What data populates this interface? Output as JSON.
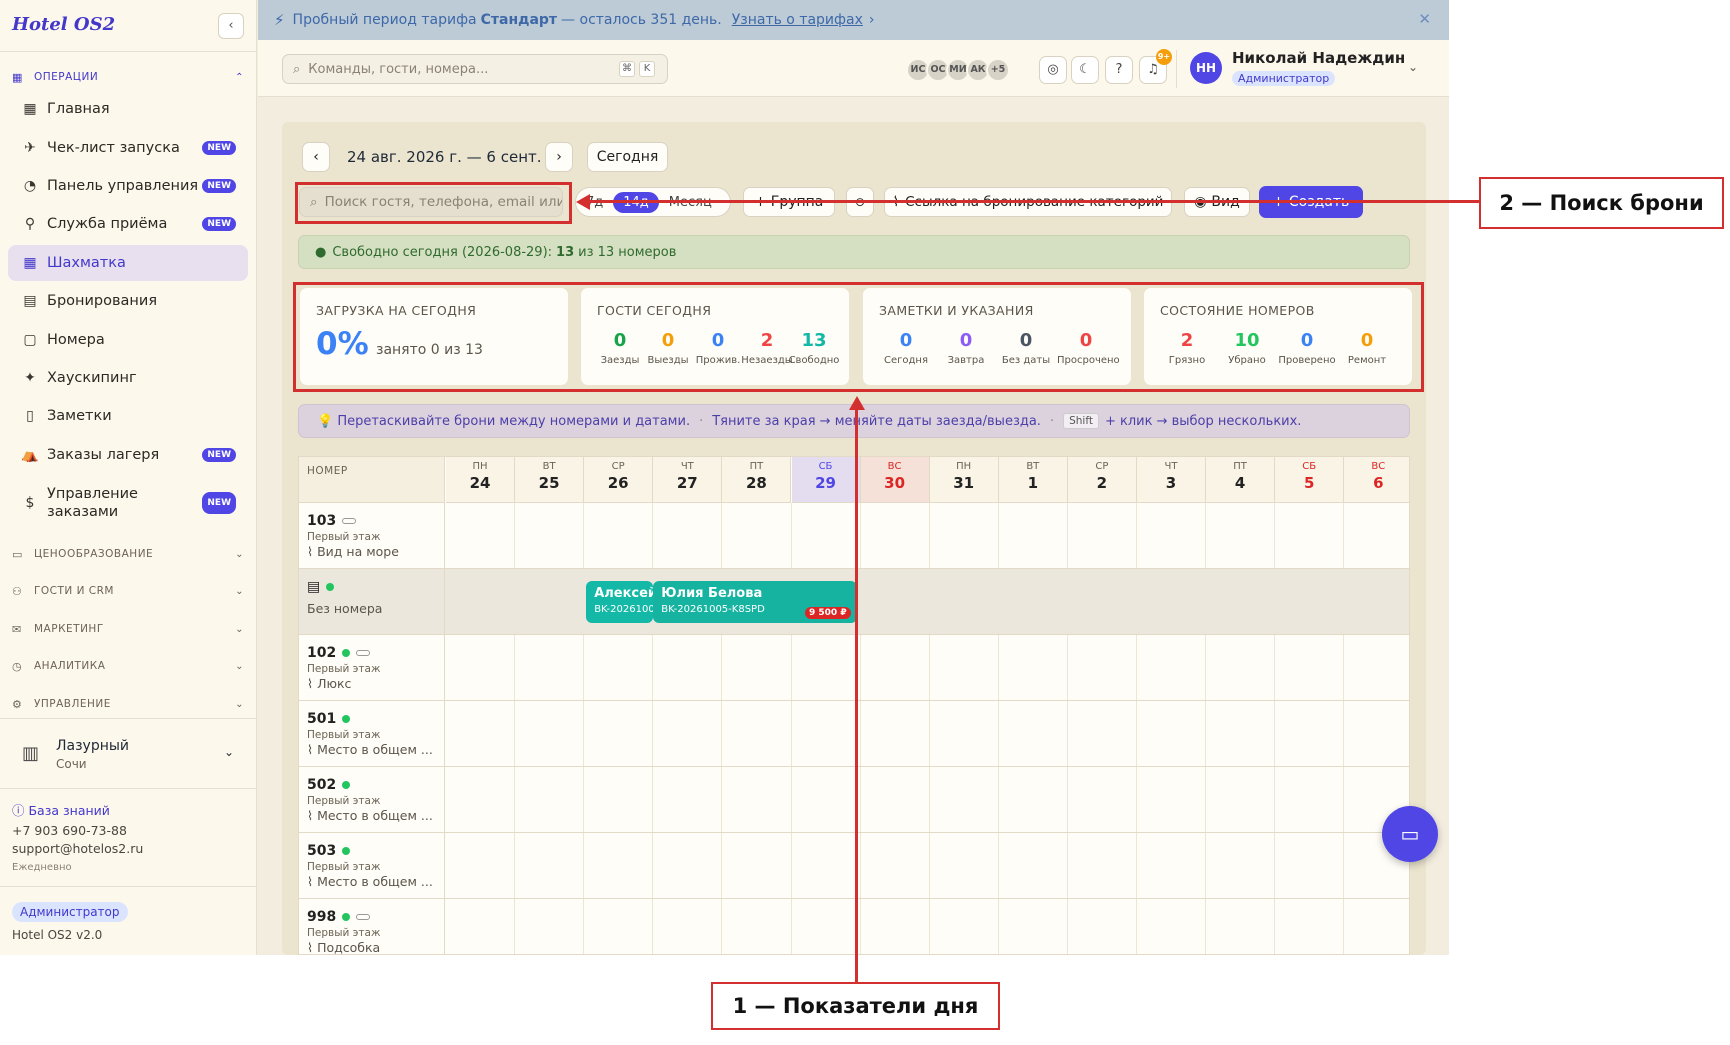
{
  "sidebar": {
    "logo": "Hotel OS2",
    "collapse_icon": "‹",
    "ops_section": "ОПЕРАЦИИ",
    "nav": [
      {
        "label": "Главная",
        "icon": "▦",
        "new": false
      },
      {
        "label": "Чек-лист запуска",
        "icon": "✈",
        "new": true
      },
      {
        "label": "Панель управления",
        "icon": "◔",
        "new": true
      },
      {
        "label": "Служба приёма",
        "icon": "⚲",
        "new": true
      },
      {
        "label": "Шахматка",
        "icon": "▦",
        "new": false,
        "active": true
      },
      {
        "label": "Бронирования",
        "icon": "▤",
        "new": false
      },
      {
        "label": "Номера",
        "icon": "▢",
        "new": false
      },
      {
        "label": "Хаускипинг",
        "icon": "✦",
        "new": false
      },
      {
        "label": "Заметки",
        "icon": "▯",
        "new": false
      },
      {
        "label": "Заказы лагеря",
        "icon": "⛺",
        "new": true
      }
    ],
    "nav_orders": {
      "label_line1": "Управление",
      "label_line2": "заказами",
      "icon": "$",
      "new": true
    },
    "new_badge": "NEW",
    "sections": [
      "ЦЕНООБРАЗОВАНИЕ",
      "ГОСТИ И CRM",
      "МАРКЕТИНГ",
      "АНАЛИТИКА",
      "УПРАВЛЕНИЕ"
    ],
    "property": {
      "name": "Лазурный",
      "city": "Сочи"
    },
    "knowledge_base": "База знаний",
    "phone": "+7 903 690-73-88",
    "email": "support@hotelos2.ru",
    "schedule": "Ежедневно",
    "role": "Администратор",
    "version": "Hotel OS2 v2.0"
  },
  "banner": {
    "text_before": "Пробный период тарифа",
    "plan": "Стандарт",
    "text_after": "— осталось 351 день.",
    "link": "Узнать о тарифах",
    "link_arrow": "›",
    "close": "✕"
  },
  "header": {
    "search_placeholder": "Команды, гости, номера...",
    "kbd1": "⌘",
    "kbd2": "K",
    "avatars": [
      "ИС",
      "ОС",
      "МИ",
      "АК",
      "+5"
    ],
    "notif_badge": "9+",
    "user_initials": "НН",
    "user_name": "Николай Надеждин",
    "user_role": "Администратор"
  },
  "toolbar": {
    "prev": "‹",
    "date_range": "24 авг. 2026 г. — 6 сент.",
    "next": "›",
    "today": "Сегодня",
    "search_placeholder": "Поиск гостя, телефона, email или",
    "seg_7d": "7д",
    "seg_14d": "14д",
    "seg_month": "Месяц",
    "group": "+ Группа",
    "link": "Ссылка на бронирование категорий",
    "view": "Вид",
    "create": "+ Создать"
  },
  "free_today": {
    "prefix": "Свободно сегодня (2026-08-29):",
    "free": "13",
    "suffix": "из 13 номеров"
  },
  "cards": {
    "load": {
      "title": "ЗАГРУЗКА НА СЕГОДНЯ",
      "percent": "0%",
      "sub": "занято 0 из 13"
    },
    "guests": {
      "title": "ГОСТИ СЕГОДНЯ",
      "stats": [
        {
          "value": "0",
          "label": "Заезды",
          "color": "#16a34a"
        },
        {
          "value": "0",
          "label": "Выезды",
          "color": "#f59e0b"
        },
        {
          "value": "0",
          "label": "Прожив.",
          "color": "#3b82f6"
        },
        {
          "value": "2",
          "label": "Незаезды",
          "color": "#ef4444"
        },
        {
          "value": "13",
          "label": "Свободно",
          "color": "#14b8a6"
        }
      ]
    },
    "notes": {
      "title": "ЗАМЕТКИ И УКАЗАНИЯ",
      "stats": [
        {
          "value": "0",
          "label": "Сегодня",
          "color": "#3b82f6"
        },
        {
          "value": "0",
          "label": "Завтра",
          "color": "#8b5cf6"
        },
        {
          "value": "0",
          "label": "Без даты",
          "color": "#4b5563"
        },
        {
          "value": "0",
          "label": "Просрочено",
          "color": "#ef4444"
        }
      ]
    },
    "rooms": {
      "title": "СОСТОЯНИЕ НОМЕРОВ",
      "stats": [
        {
          "value": "2",
          "label": "Грязно",
          "color": "#ef4444"
        },
        {
          "value": "10",
          "label": "Убрано",
          "color": "#22c55e"
        },
        {
          "value": "0",
          "label": "Проверено",
          "color": "#3b82f6"
        },
        {
          "value": "0",
          "label": "Ремонт",
          "color": "#f59e0b"
        }
      ]
    }
  },
  "hint": {
    "part1": "💡 Перетаскивайте брони между номерами и датами.",
    "sep": "·",
    "part2": "Тяните за края → меняйте даты заезда/выезда.",
    "kbd": "Shift",
    "part3": "+ клик → выбор нескольких."
  },
  "grid": {
    "room_header": "НОМЕР",
    "days": [
      {
        "dow": "ПН",
        "num": "24"
      },
      {
        "dow": "ВТ",
        "num": "25"
      },
      {
        "dow": "СР",
        "num": "26"
      },
      {
        "dow": "ЧТ",
        "num": "27"
      },
      {
        "dow": "ПТ",
        "num": "28"
      },
      {
        "dow": "СБ",
        "num": "29",
        "today": true
      },
      {
        "dow": "ВС",
        "num": "30",
        "weekend": true
      },
      {
        "dow": "ПН",
        "num": "31"
      },
      {
        "dow": "ВТ",
        "num": "1"
      },
      {
        "dow": "СР",
        "num": "2"
      },
      {
        "dow": "ЧТ",
        "num": "3"
      },
      {
        "dow": "ПТ",
        "num": "4"
      },
      {
        "dow": "СБ",
        "num": "5",
        "weekend": true
      },
      {
        "dow": "ВС",
        "num": "6",
        "weekend": true
      }
    ],
    "rows": [
      {
        "num": "103",
        "dot": false,
        "pill": true,
        "floor": "Первый этаж",
        "type": "Вид на море"
      },
      {
        "num": "",
        "unassigned": true,
        "label": "Без номера"
      },
      {
        "num": "102",
        "dot": true,
        "pill": true,
        "floor": "Первый этаж",
        "type": "Люкс"
      },
      {
        "num": "501",
        "dot": true,
        "pill": false,
        "floor": "Первый этаж",
        "type": "Место в общем ..."
      },
      {
        "num": "502",
        "dot": true,
        "pill": false,
        "floor": "Первый этаж",
        "type": "Место в общем ..."
      },
      {
        "num": "503",
        "dot": true,
        "pill": false,
        "floor": "Первый этаж",
        "type": "Место в общем ..."
      },
      {
        "num": "998",
        "dot": true,
        "pill": true,
        "floor": "Первый этаж",
        "type": "Подсобка"
      }
    ],
    "bookings": [
      {
        "name": "Алексей",
        "code": "BK-2026100"
      },
      {
        "name": "Юлия Белова",
        "code": "BK-20261005-K8SPD",
        "price": "9 500 ₽"
      }
    ]
  },
  "annotations": {
    "label1": "1 — Показатели дня",
    "label2": "2 — Поиск брони"
  }
}
